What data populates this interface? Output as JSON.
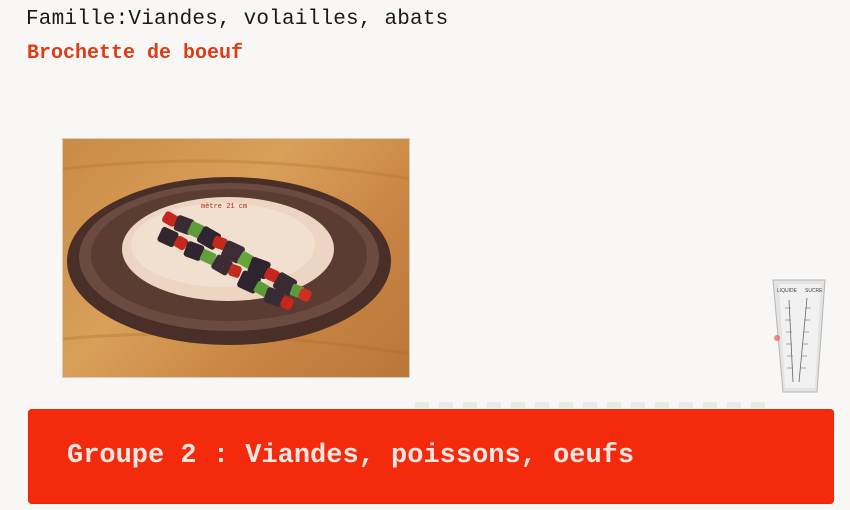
{
  "header": {
    "family": "Famille:Viandes, volailles, abats",
    "dish": "Brochette de boeuf"
  },
  "photo": {
    "caption": "mètre 21 cm",
    "description_icon": "plate-skewer-image"
  },
  "measuring_cup": {
    "label_left": "LIQUIDE",
    "label_right": "SUCRE"
  },
  "group": {
    "label": "Groupe 2 : Viandes, poissons, oeufs"
  },
  "colors": {
    "title_red": "#de3c14",
    "banner_red": "#f42a0c",
    "banner_text": "#fbe6e2"
  }
}
